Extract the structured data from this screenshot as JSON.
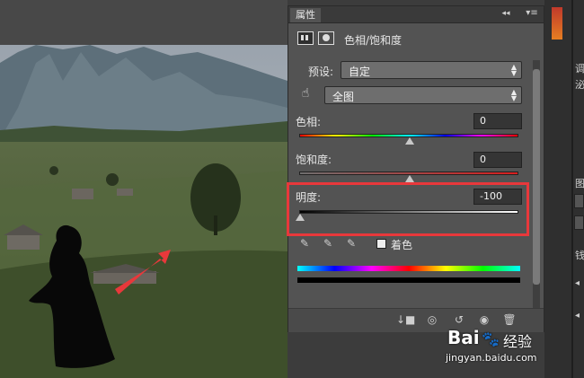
{
  "panel": {
    "tab_label": "属性",
    "adjustment_title": "色相/饱和度",
    "preset_label": "预设:",
    "preset_value": "自定",
    "channel_value": "全图",
    "hue_label": "色相:",
    "hue_value": "0",
    "saturation_label": "饱和度:",
    "saturation_value": "0",
    "lightness_label": "明度:",
    "lightness_value": "-100",
    "colorize_label": "着色"
  },
  "right_dock": {
    "label_1": "调",
    "label_2": "泌",
    "label_3": "图",
    "label_4": "钱"
  },
  "watermark": {
    "brand": "Bai",
    "brand_suffix": "经验",
    "url": "jingyan.baidu.com"
  },
  "colors": {
    "highlight_box": "#e8383b",
    "arrow": "#e8383b",
    "panel_bg": "#535353",
    "dock_bg": "#2f2f2f"
  },
  "slider_levels": {
    "hue": 0,
    "saturation": 0,
    "lightness": -100
  }
}
